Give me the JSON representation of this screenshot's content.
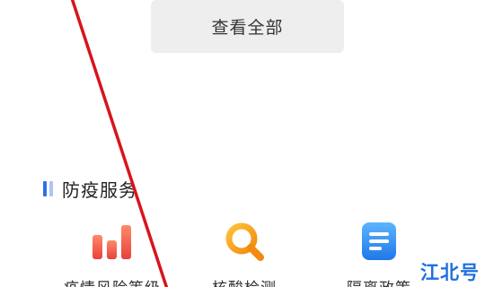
{
  "view_all": {
    "label": "查看全部"
  },
  "section": {
    "title": "防疫服务",
    "marker_colors": [
      "#2f6fe4",
      "#a9c6f5"
    ]
  },
  "services": [
    {
      "label": "疫情风险等级",
      "icon": "bar-chart-icon",
      "color": "#f0584c"
    },
    {
      "label": "核酸检测",
      "icon": "magnifier-icon",
      "color": "#f5a020"
    },
    {
      "label": "隔离政策",
      "icon": "document-icon",
      "color": "#2d8cf0"
    }
  ],
  "watermark": {
    "text": "江北号",
    "color": "#1f6fe0"
  },
  "annotation_line": {
    "color": "#d8141c"
  }
}
